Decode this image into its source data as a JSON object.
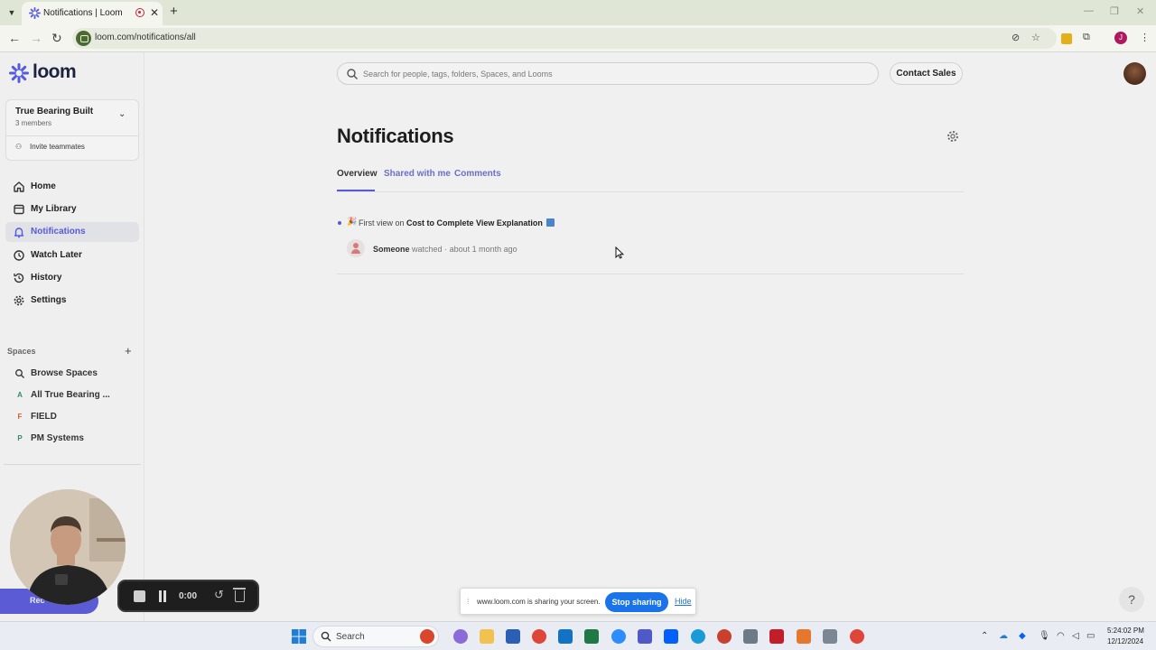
{
  "browser": {
    "tab_title": "Notifications | Loom",
    "url": "loom.com/notifications/all",
    "profile_initial": "J"
  },
  "app": {
    "logo_text": "loom",
    "brand_color": "#565add"
  },
  "workspace": {
    "name": "True Bearing Built",
    "members": "3 members",
    "invite_label": "Invite teammates"
  },
  "nav": {
    "home": "Home",
    "library": "My Library",
    "notifications": "Notifications",
    "watch_later": "Watch Later",
    "history": "History",
    "settings": "Settings"
  },
  "spaces": {
    "header": "Spaces",
    "browse": "Browse Spaces",
    "items": [
      {
        "badge": "A",
        "label": "All True Bearing ...",
        "color": "#3a8a5e"
      },
      {
        "badge": "F",
        "label": "FIELD",
        "color": "#d0612c"
      },
      {
        "badge": "P",
        "label": "PM Systems",
        "color": "#3a8a5e"
      }
    ]
  },
  "header": {
    "search_placeholder": "Search for people, tags, folders, Spaces, and Looms",
    "contact_sales": "Contact Sales"
  },
  "page": {
    "title": "Notifications",
    "tabs": [
      {
        "label": "Overview",
        "active": true
      },
      {
        "label": "Shared with me",
        "active": false
      },
      {
        "label": "Comments",
        "active": false
      }
    ]
  },
  "notification": {
    "emoji": "🎉",
    "prefix": "First view on",
    "video_title": "Cost to Complete View Explanation",
    "user": "Someone",
    "action": "watched",
    "separator": "·",
    "time": "about 1 month ago"
  },
  "recorder": {
    "pill_label": "Rec",
    "timer": "0:00"
  },
  "share_bar": {
    "message": "www.loom.com is sharing your screen.",
    "stop_label": "Stop sharing",
    "hide_label": "Hide"
  },
  "help": {
    "label": "?"
  },
  "taskbar": {
    "search_label": "Search",
    "time": "5:24:02 PM",
    "date": "12/12/2024"
  }
}
